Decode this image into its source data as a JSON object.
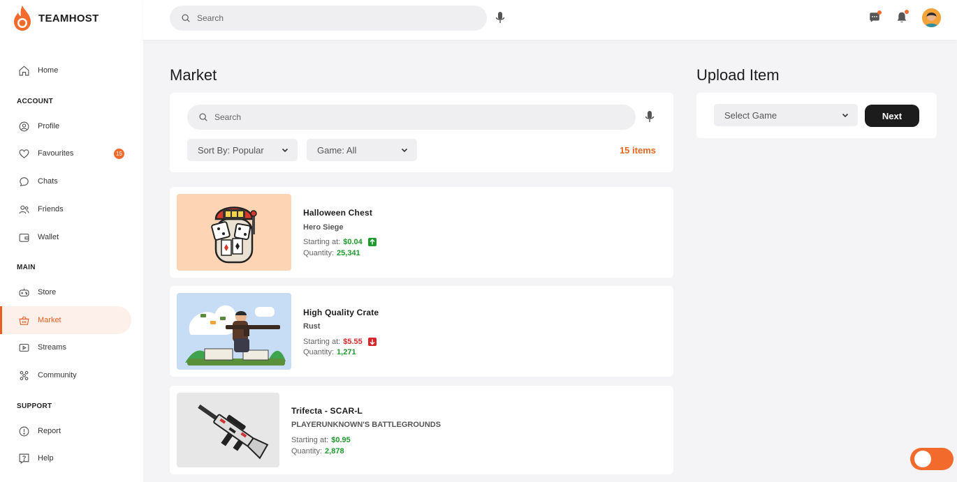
{
  "brand": {
    "name": "TEAMHOST",
    "accent": "#e85d20"
  },
  "topbar": {
    "search_placeholder": "Search"
  },
  "sidebar": {
    "home": "Home",
    "section_account": "ACCOUNT",
    "profile": "Profile",
    "favourites": "Favourites",
    "favourites_badge": "15",
    "chats": "Chats",
    "friends": "Friends",
    "wallet": "Wallet",
    "section_main": "MAIN",
    "store": "Store",
    "market": "Market",
    "streams": "Streams",
    "community": "Community",
    "section_support": "SUPPORT",
    "report": "Report",
    "help": "Help"
  },
  "market": {
    "title": "Market",
    "search_placeholder": "Search",
    "sort_label": "Sort By: Popular",
    "game_filter": "Game: All",
    "items_count": "15 items",
    "items": [
      {
        "name": "Halloween Chest",
        "game": "Hero Siege",
        "start_label": "Starting at:",
        "price": "$0.04",
        "trend": "up",
        "qty_label": "Quantity:",
        "quantity": "25,341"
      },
      {
        "name": "High Quality Crate",
        "game": "Rust",
        "start_label": "Starting at:",
        "price": "$5.55",
        "trend": "down",
        "qty_label": "Quantity:",
        "quantity": "1,271"
      },
      {
        "name": "Trifecta - SCAR-L",
        "game": "PLAYERUNKNOWN'S BATTLEGROUNDS",
        "start_label": "Starting at:",
        "price": "$0.95",
        "qty_label": "Quantity:",
        "quantity": "2,878"
      }
    ]
  },
  "upload": {
    "title": "Upload Item",
    "select_game": "Select Game",
    "next_label": "Next"
  }
}
